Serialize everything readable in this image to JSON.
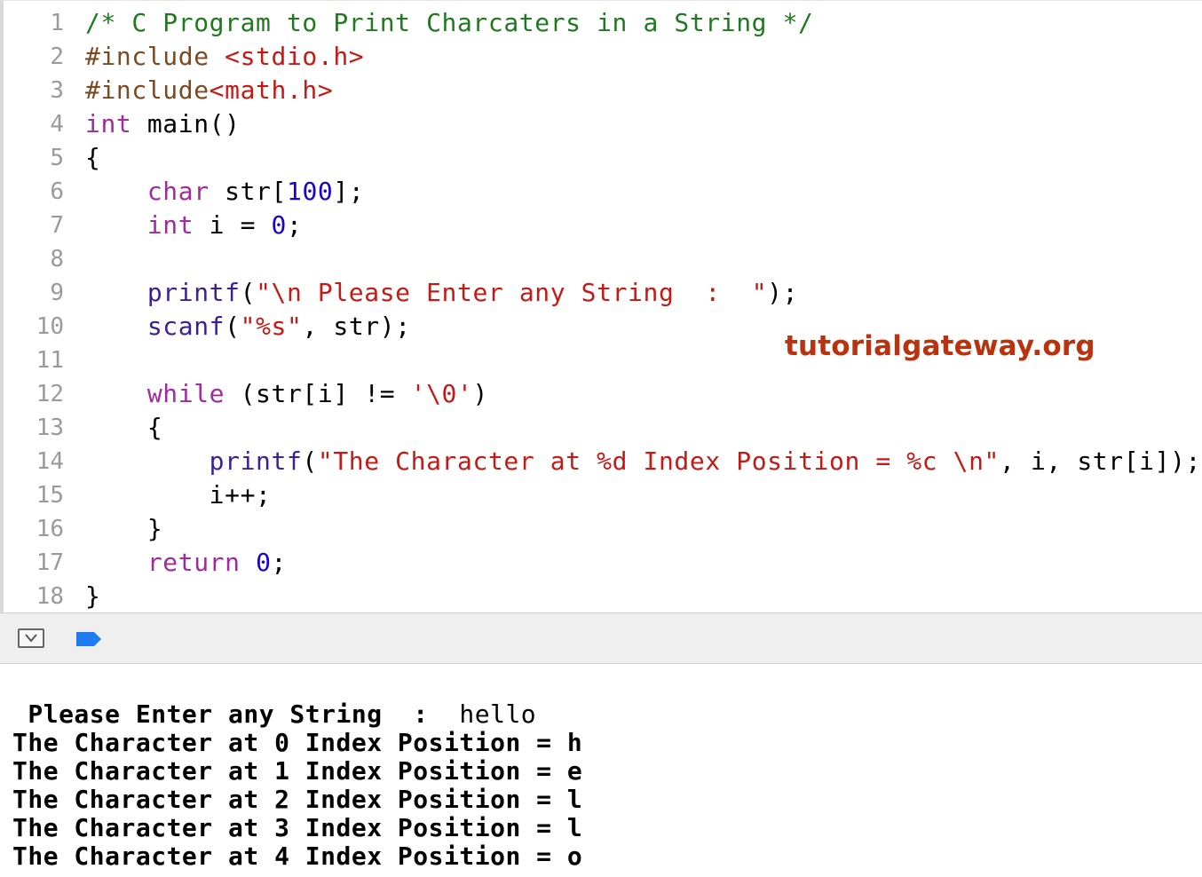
{
  "editor": {
    "lines": [
      {
        "n": "1",
        "segs": [
          {
            "t": "/* C Program to Print Charcaters in a String */",
            "k": "comment"
          }
        ]
      },
      {
        "n": "2",
        "segs": [
          {
            "t": "#include ",
            "k": "pre"
          },
          {
            "t": "<stdio.h>",
            "k": "str"
          }
        ]
      },
      {
        "n": "3",
        "segs": [
          {
            "t": "#include",
            "k": "pre"
          },
          {
            "t": "<math.h>",
            "k": "str"
          }
        ]
      },
      {
        "n": "4",
        "segs": [
          {
            "t": "int",
            "k": "kw"
          },
          {
            "t": " main()",
            "k": "plain"
          }
        ]
      },
      {
        "n": "5",
        "segs": [
          {
            "t": "{",
            "k": "plain"
          }
        ]
      },
      {
        "n": "6",
        "segs": [
          {
            "t": "    ",
            "k": "plain"
          },
          {
            "t": "char",
            "k": "kw"
          },
          {
            "t": " str[",
            "k": "plain"
          },
          {
            "t": "100",
            "k": "num"
          },
          {
            "t": "];",
            "k": "plain"
          }
        ]
      },
      {
        "n": "7",
        "segs": [
          {
            "t": "    ",
            "k": "plain"
          },
          {
            "t": "int",
            "k": "kw"
          },
          {
            "t": " i = ",
            "k": "plain"
          },
          {
            "t": "0",
            "k": "num"
          },
          {
            "t": ";",
            "k": "plain"
          }
        ]
      },
      {
        "n": "8",
        "segs": []
      },
      {
        "n": "9",
        "segs": [
          {
            "t": "    ",
            "k": "plain"
          },
          {
            "t": "printf",
            "k": "fn"
          },
          {
            "t": "(",
            "k": "plain"
          },
          {
            "t": "\"\\n Please Enter any String  :  \"",
            "k": "str"
          },
          {
            "t": ");",
            "k": "plain"
          }
        ]
      },
      {
        "n": "10",
        "segs": [
          {
            "t": "    ",
            "k": "plain"
          },
          {
            "t": "scanf",
            "k": "fn"
          },
          {
            "t": "(",
            "k": "plain"
          },
          {
            "t": "\"%s\"",
            "k": "str"
          },
          {
            "t": ", str);",
            "k": "plain"
          }
        ]
      },
      {
        "n": "11",
        "segs": []
      },
      {
        "n": "12",
        "segs": [
          {
            "t": "    ",
            "k": "plain"
          },
          {
            "t": "while",
            "k": "kw"
          },
          {
            "t": " (str[i] != ",
            "k": "plain"
          },
          {
            "t": "'\\0'",
            "k": "str"
          },
          {
            "t": ")",
            "k": "plain"
          }
        ]
      },
      {
        "n": "13",
        "segs": [
          {
            "t": "    {",
            "k": "plain"
          }
        ]
      },
      {
        "n": "14",
        "segs": [
          {
            "t": "        ",
            "k": "plain"
          },
          {
            "t": "printf",
            "k": "fn"
          },
          {
            "t": "(",
            "k": "plain"
          },
          {
            "t": "\"The Character at %d Index Position = %c \\n\"",
            "k": "str"
          },
          {
            "t": ", i, str[i]);",
            "k": "plain"
          }
        ]
      },
      {
        "n": "15",
        "segs": [
          {
            "t": "        i++;",
            "k": "plain"
          }
        ]
      },
      {
        "n": "16",
        "segs": [
          {
            "t": "    }",
            "k": "plain"
          }
        ]
      },
      {
        "n": "17",
        "segs": [
          {
            "t": "    ",
            "k": "plain"
          },
          {
            "t": "return",
            "k": "kw"
          },
          {
            "t": " ",
            "k": "plain"
          },
          {
            "t": "0",
            "k": "num"
          },
          {
            "t": ";",
            "k": "plain"
          }
        ]
      },
      {
        "n": "18",
        "segs": [
          {
            "t": "}",
            "k": "plain"
          }
        ]
      }
    ]
  },
  "watermark": "tutorialgateway.org",
  "debug_bar": {
    "toggle_icon": "hide-console-icon",
    "breakpoint_icon": "breakpoint-icon",
    "breakpoint_color": "#1e7bf0"
  },
  "console": {
    "prompt": " Please Enter any String  :  ",
    "input": "hello",
    "outputs": [
      "The Character at 0 Index Position = h",
      "The Character at 1 Index Position = e",
      "The Character at 2 Index Position = l",
      "The Character at 3 Index Position = l",
      "The Character at 4 Index Position = o"
    ]
  }
}
